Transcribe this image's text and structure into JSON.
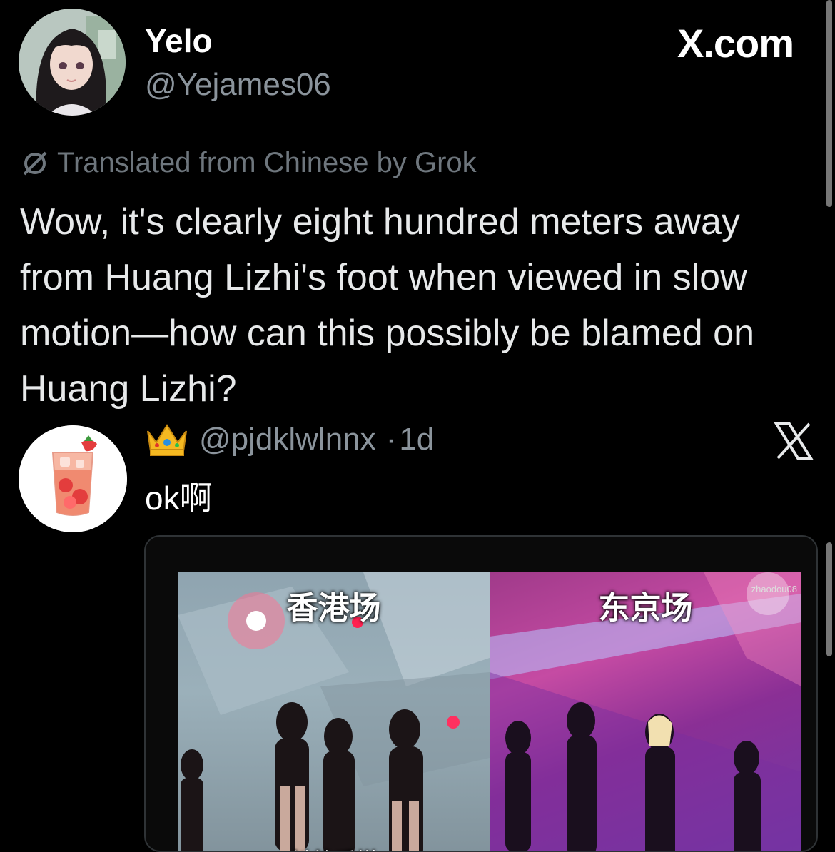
{
  "tweet": {
    "display_name": "Yelo",
    "handle": "@Yejames06",
    "site_label": "X.com",
    "translation_note": "Translated from Chinese by Grok",
    "body": "Wow, it's clearly eight hundred meters away from Huang Lizhi's foot when viewed in slow motion—how can this possibly be blamed on Huang Lizhi?"
  },
  "reply": {
    "handle": "@pjdklwlnnx",
    "separator": "·",
    "time": "1d",
    "text": "ok啊",
    "badge_icon": "crown-emoji",
    "avatar_icon": "strawberry-drink-icon"
  },
  "media": {
    "left_caption": "香港场",
    "right_caption": "东京场",
    "left_subcaption": "斜着后撤",
    "watermark": "zhaodou08"
  },
  "colors": {
    "background": "#000000",
    "text_primary": "#e7e9ea",
    "text_secondary": "#8b949c"
  }
}
